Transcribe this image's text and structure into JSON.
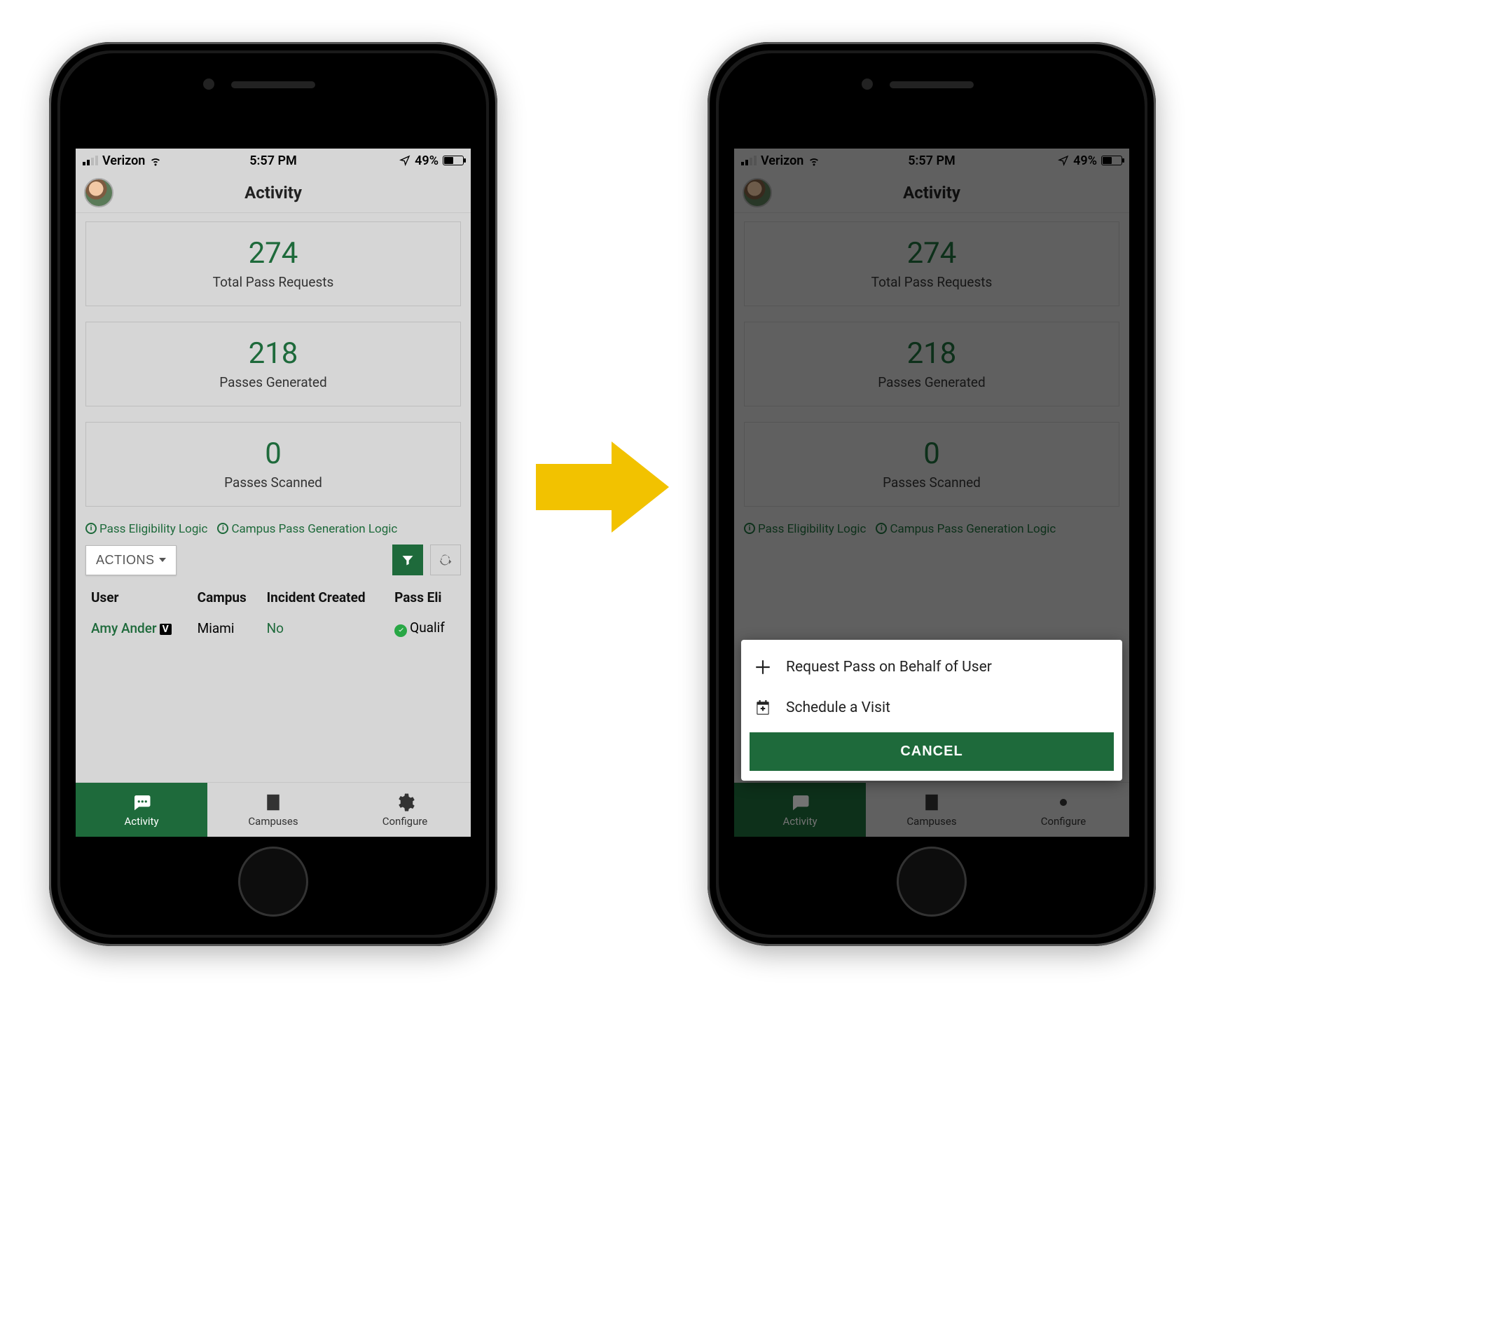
{
  "statusbar": {
    "carrier": "Verizon",
    "time": "5:57 PM",
    "battery_pct": "49%"
  },
  "header": {
    "title": "Activity"
  },
  "cards": [
    {
      "value": "274",
      "label": "Total Pass Requests"
    },
    {
      "value": "218",
      "label": "Passes Generated"
    },
    {
      "value": "0",
      "label": "Passes Scanned"
    }
  ],
  "logic_links": {
    "eligibility": "Pass Eligibility Logic",
    "campus": "Campus Pass Generation Logic"
  },
  "toolbar": {
    "actions_label": "ACTIONS"
  },
  "table": {
    "headers": {
      "user": "User",
      "campus": "Campus",
      "incident": "Incident Created",
      "eligible": "Pass Eli"
    },
    "rows": [
      {
        "user": "Amy Ander",
        "badge": "V",
        "campus": "Miami",
        "incident": "No",
        "eligible": "Qualif"
      }
    ]
  },
  "tabs": {
    "activity": "Activity",
    "campuses": "Campuses",
    "configure": "Configure"
  },
  "actionsheet": {
    "request": "Request Pass on Behalf of User",
    "schedule": "Schedule a Visit",
    "cancel": "CANCEL"
  }
}
